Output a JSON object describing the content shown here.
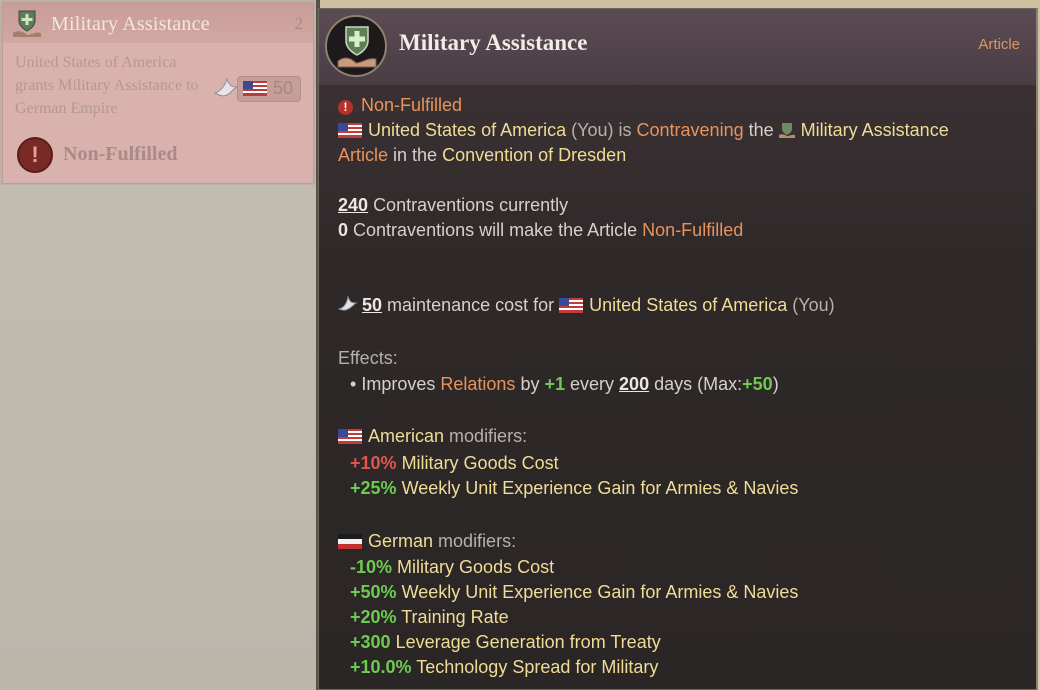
{
  "card": {
    "title": "Military Assistance",
    "count": "2",
    "description": "United States of America grants Military Assistance to German Empire",
    "cost": "50",
    "status": "Non-Fulfilled"
  },
  "tooltip": {
    "title": "Military Assistance",
    "type_label": "Article",
    "status": "Non-Fulfilled",
    "line1": {
      "country": "United States of America",
      "you": "(You) is",
      "verb": "Contravening",
      "the": "the",
      "article": "Military Assistance",
      "article_word": "Article",
      "in_the": "in the",
      "convention": "Convention of Dresden"
    },
    "contraventions": {
      "current_value": "240",
      "current_text": "Contraventions currently",
      "threshold_value": "0",
      "threshold_text": "Contraventions will make the Article",
      "threshold_status": "Non-Fulfilled"
    },
    "maintenance": {
      "value": "50",
      "text": "maintenance cost for",
      "country": "United States of America",
      "you": "(You)"
    },
    "effects": {
      "label": "Effects:",
      "bullet": "•",
      "improves": "Improves",
      "relations": "Relations",
      "by": "by",
      "amount": "+1",
      "every": "every",
      "days_value": "200",
      "days_text": "days (Max:",
      "max": "+50",
      "close": ")"
    },
    "american": {
      "label": "American",
      "suffix": "modifiers:",
      "mods": [
        {
          "value": "+10%",
          "text": "Military Goods Cost",
          "color": "#e0554f"
        },
        {
          "value": "+25%",
          "text": "Weekly Unit Experience Gain for Armies & Navies",
          "color": "#6ccb50"
        }
      ]
    },
    "german": {
      "label": "German",
      "suffix": "modifiers:",
      "mods": [
        {
          "value": "-10%",
          "text": "Military Goods Cost",
          "color": "#6ccb50"
        },
        {
          "value": "+50%",
          "text": "Weekly Unit Experience Gain for Armies & Navies",
          "color": "#6ccb50"
        },
        {
          "value": "+20%",
          "text": "Training Rate",
          "color": "#6ccb50"
        },
        {
          "value": "+300",
          "text": "Leverage Generation from Treaty",
          "color": "#6ccb50"
        },
        {
          "value": "+10.0%",
          "text": "Technology Spread for Military",
          "color": "#6ccb50"
        }
      ]
    }
  }
}
